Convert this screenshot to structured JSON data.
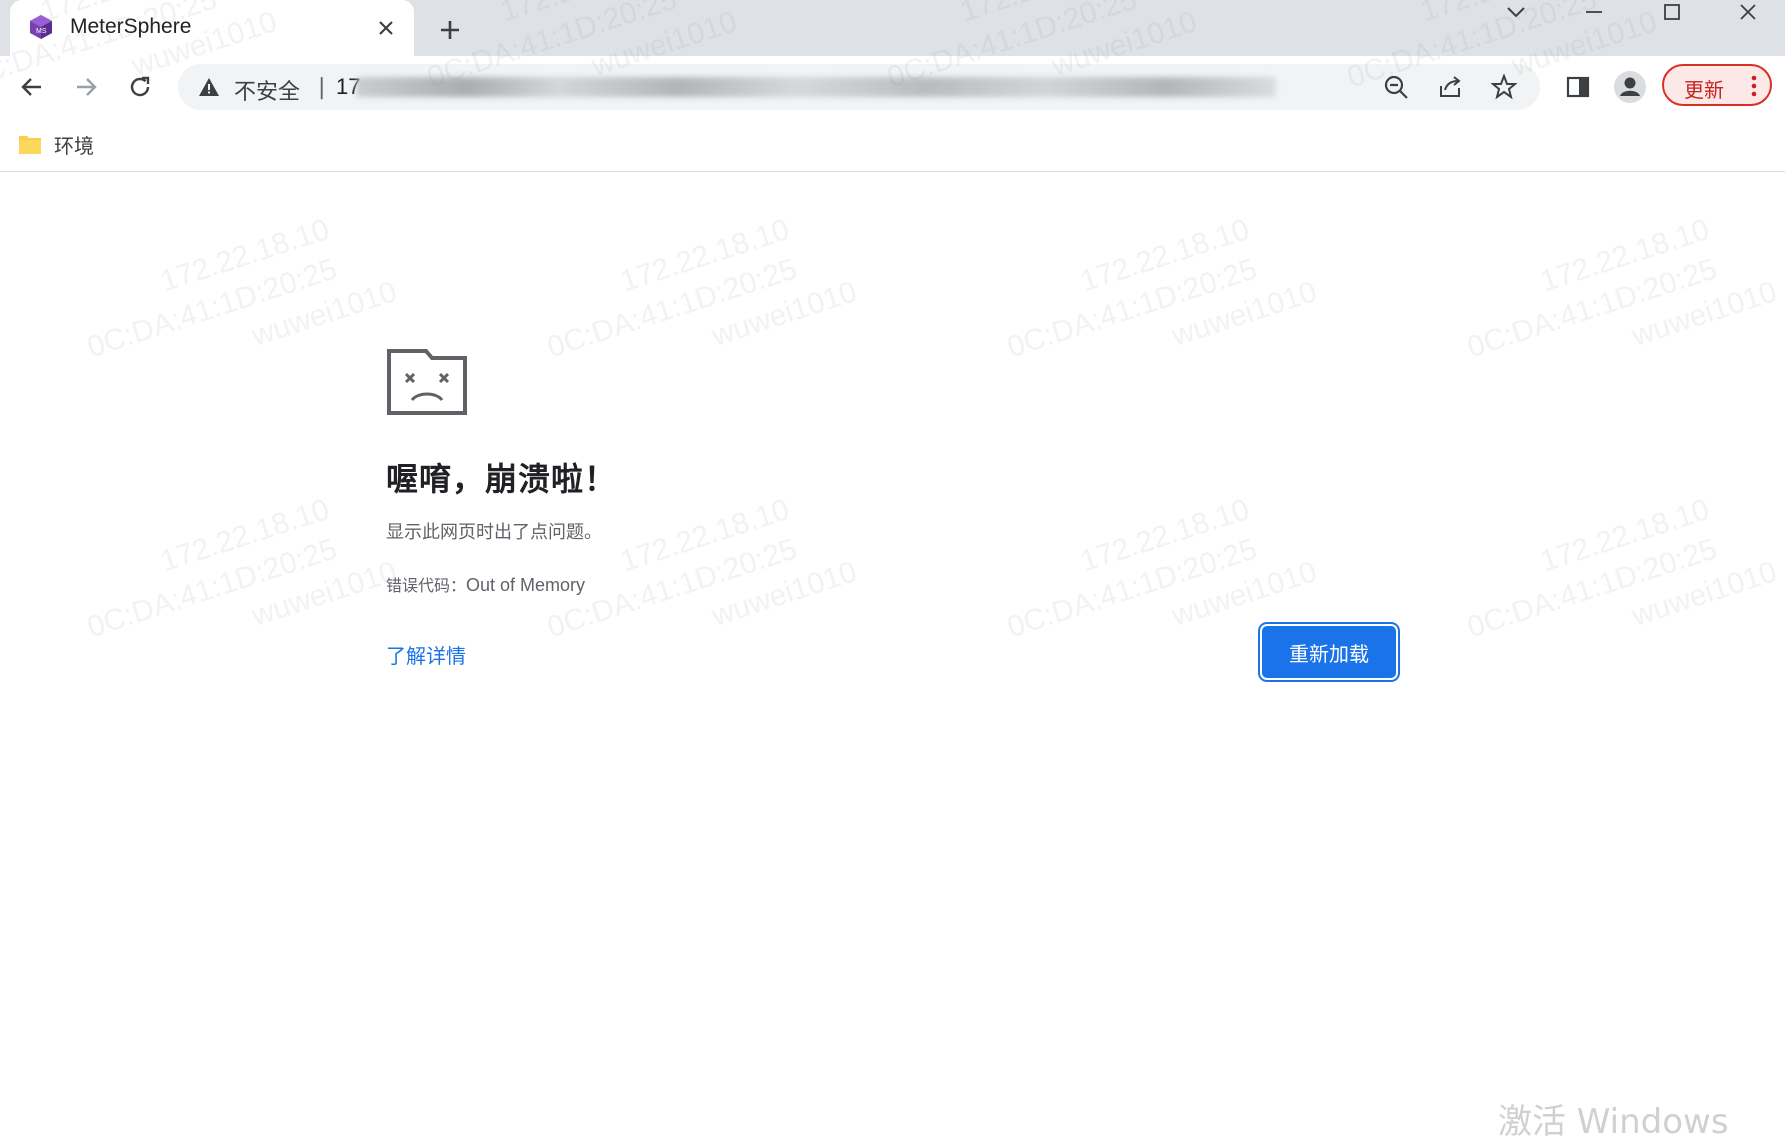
{
  "browser": {
    "tab": {
      "title": "MeterSphere",
      "favicon": "metersphere-cube-icon"
    },
    "toolbar": {
      "security_label": "不安全",
      "separator": "|",
      "url_visible_prefix": "17",
      "update_label": "更新"
    },
    "bookmarks": [
      {
        "label": "环境",
        "icon": "folder-icon"
      }
    ]
  },
  "error_page": {
    "icon": "sad-folder-icon",
    "heading": "喔唷，崩溃啦！",
    "description": "显示此网页时出了点问题。",
    "code_label": "错误代码：",
    "code_value": "Out of Memory",
    "learn_more": "了解详情",
    "reload_label": "重新加载"
  },
  "watermark": {
    "ip": "172.22.18.10",
    "mac": "0C:DA:41:1D:20:25",
    "user": "wuwei1010"
  },
  "os_overlay": {
    "activate_windows": "激活 Windows"
  },
  "colors": {
    "accent": "#1a73e8",
    "tabstrip_bg": "#dee1e6",
    "update_red": "#d93025"
  }
}
